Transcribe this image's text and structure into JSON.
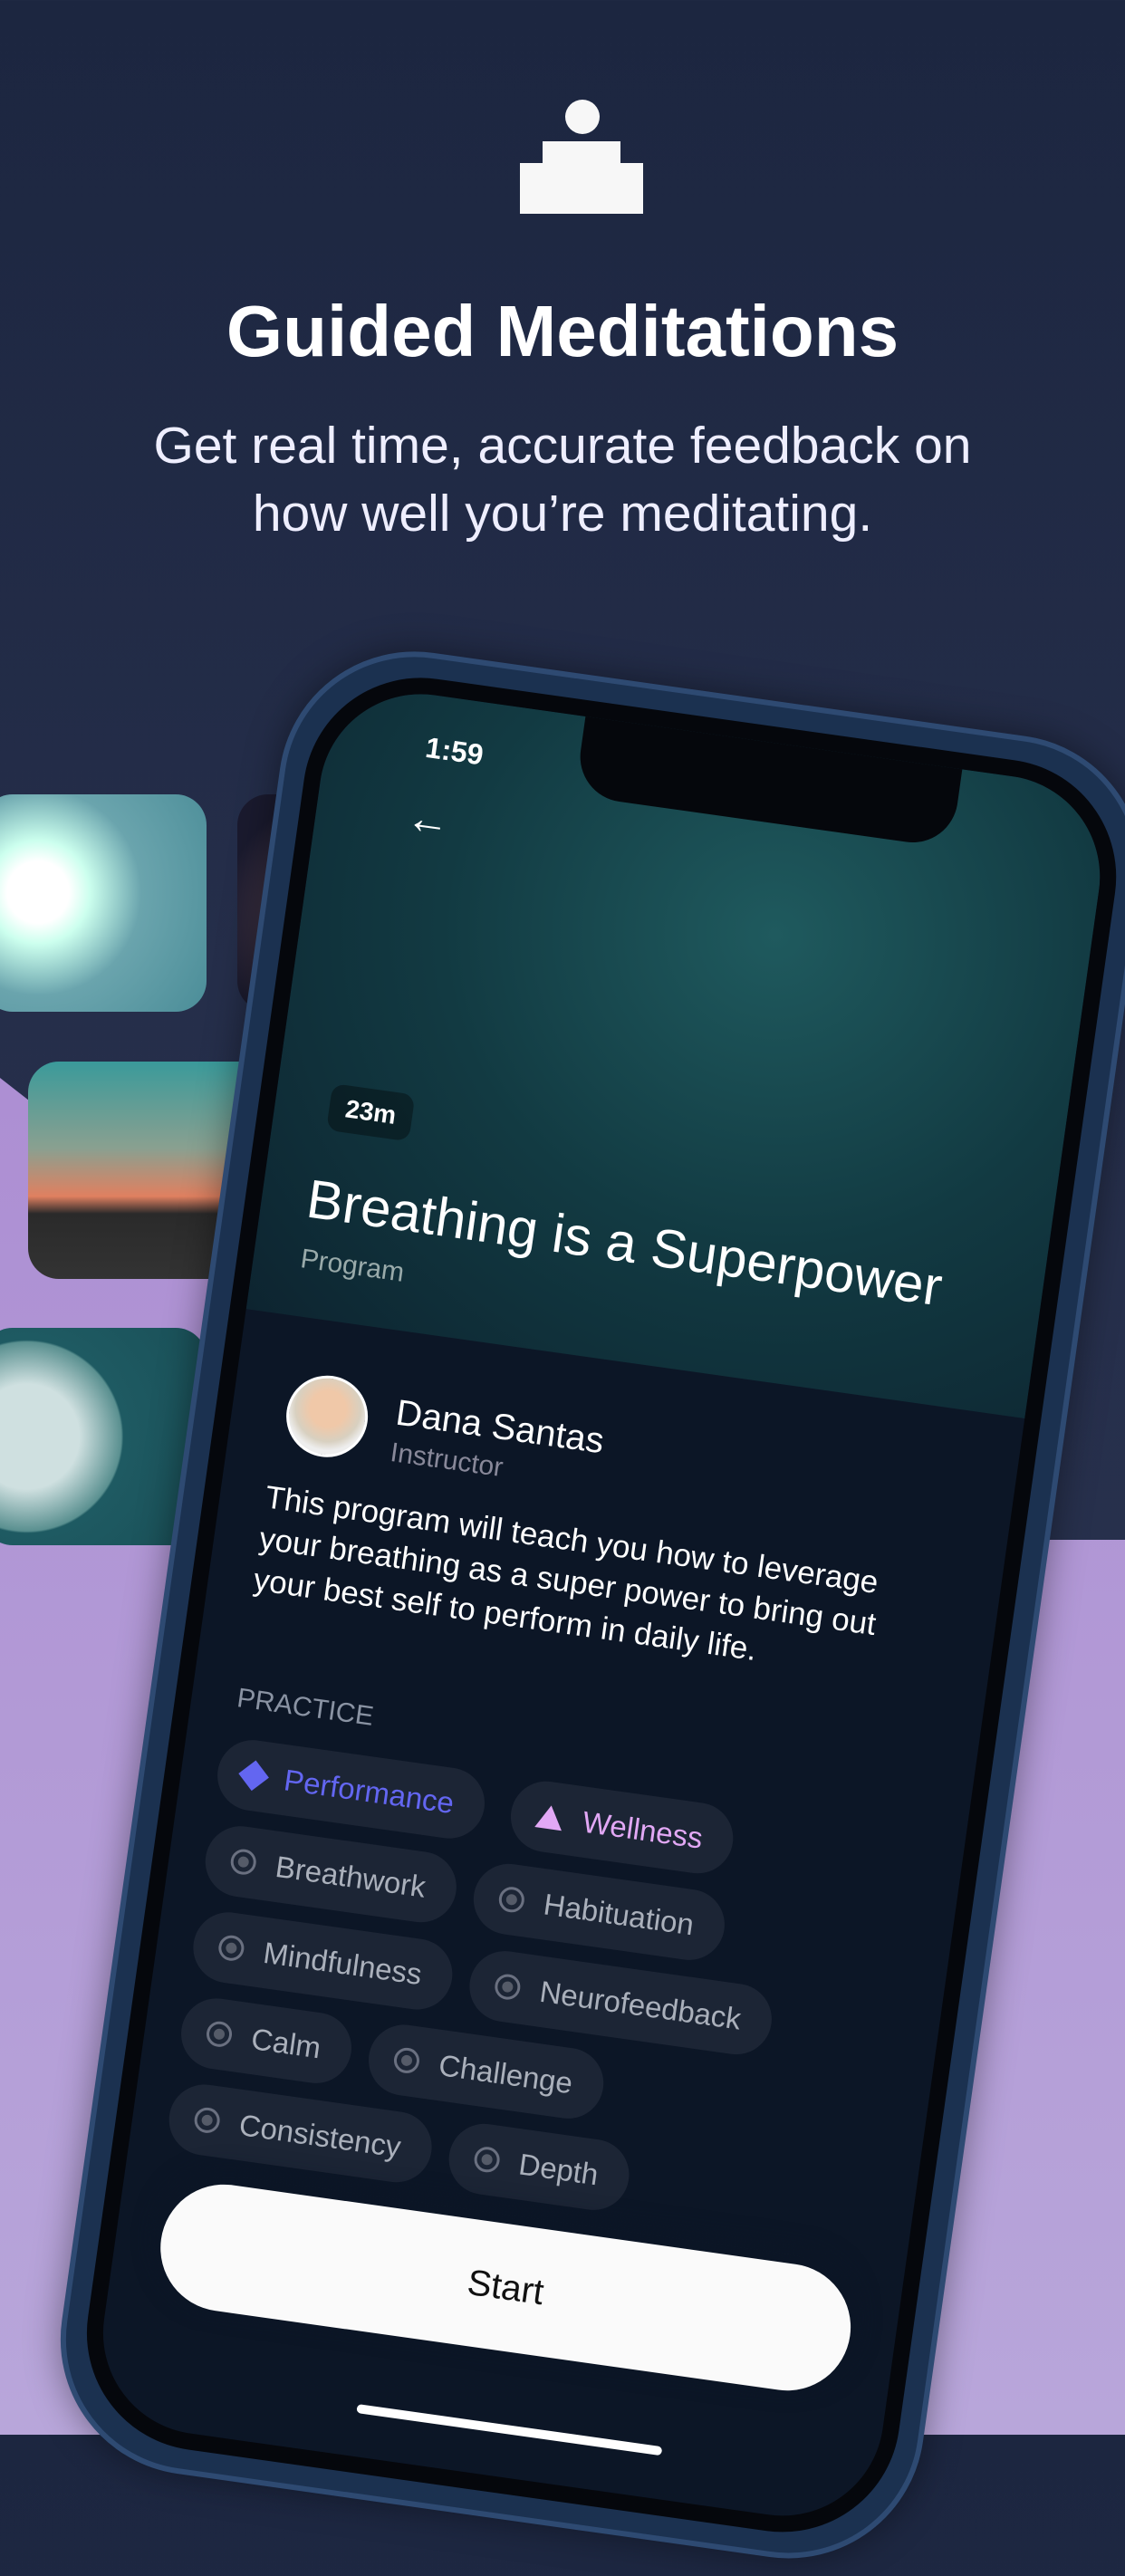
{
  "header": {
    "title": "Guided Meditations",
    "subtitle": "Get real time, accurate feedback on how well you’re meditating.",
    "icon": "podium-meditation-icon"
  },
  "phone": {
    "status_time": "1:59",
    "duration": "23m",
    "program_title": "Breathing is a Superpower",
    "program_type": "Program",
    "instructor": {
      "name": "Dana Santas",
      "role": "Instructor"
    },
    "description": "This program will teach you how to leverage your breathing as a super power to bring out your best self to perform in daily life.",
    "practice_label": "PRACTICE",
    "chips": [
      {
        "label": "Performance",
        "icon": "diamond",
        "color": "#6366f1"
      },
      {
        "label": "Wellness",
        "icon": "triangle",
        "color": "#e2a8f5"
      },
      {
        "label": "Breathwork"
      },
      {
        "label": "Habituation"
      },
      {
        "label": "Mindfulness"
      },
      {
        "label": "Neurofeedback"
      },
      {
        "label": "Calm"
      },
      {
        "label": "Challenge"
      },
      {
        "label": "Consistency"
      },
      {
        "label": "Depth"
      }
    ],
    "start_label": "Start"
  }
}
